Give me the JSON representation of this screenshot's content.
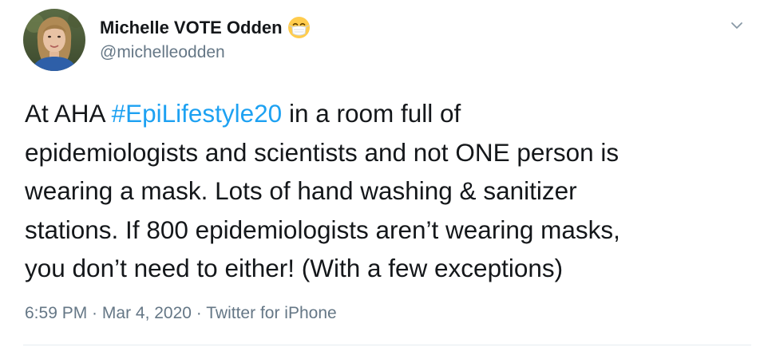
{
  "author": {
    "display_name": "Michelle VOTE Odden",
    "emoji": "face-with-medical-mask",
    "handle": "@michelleodden"
  },
  "tweet": {
    "lines": [
      {
        "pre": "At AHA ",
        "hashtag": "#EpiLifestyle20",
        "post": " in a room full of"
      },
      {
        "text": "epidemiologists and scientists and not ONE person is"
      },
      {
        "text": "wearing a mask. Lots of hand washing & sanitizer"
      },
      {
        "text": "stations. If 800 epidemiologists aren’t wearing masks,"
      },
      {
        "text": "you don’t need to either! (With a few exceptions)"
      }
    ]
  },
  "meta": {
    "time": "6:59 PM",
    "separator": " · ",
    "date": "Mar 4, 2020",
    "source": "Twitter for iPhone"
  },
  "colors": {
    "text": "#14171a",
    "secondary": "#657786",
    "link": "#1da1f2",
    "divider": "#e6ecf0"
  },
  "icons": {
    "caret": "chevron-down-icon"
  }
}
